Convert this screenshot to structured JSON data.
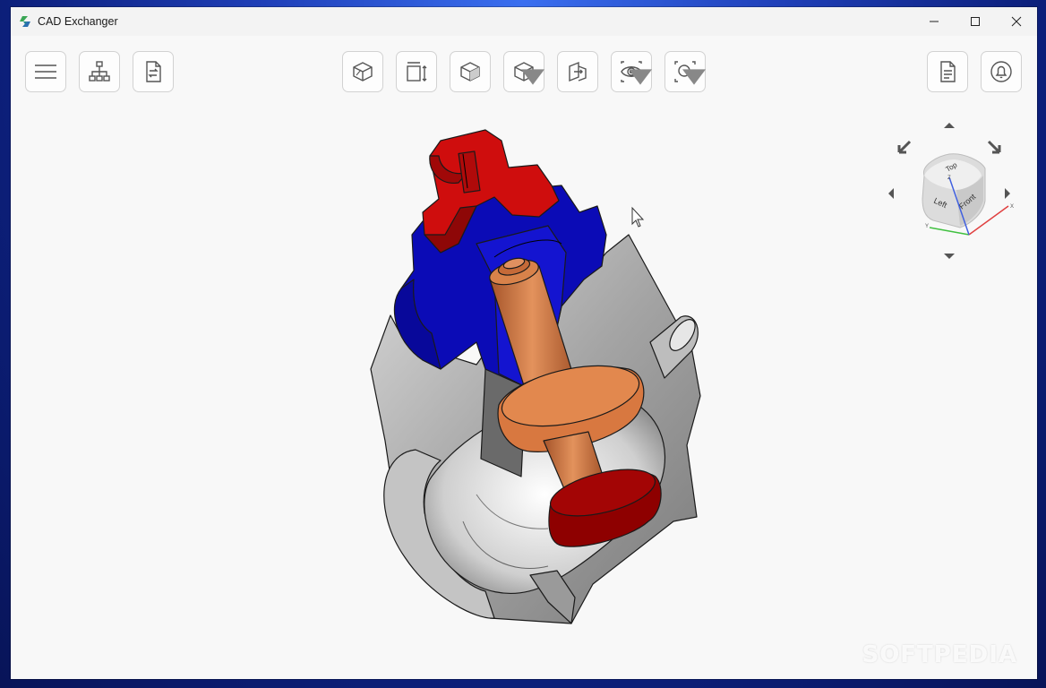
{
  "app": {
    "title": "CAD Exchanger",
    "brand_color": "#2e9a4a"
  },
  "window_controls": {
    "minimize": "minimize-icon",
    "maximize": "maximize-icon",
    "close": "close-icon"
  },
  "toolbar": {
    "left": [
      "menu-icon",
      "structure-tree-icon",
      "convert-file-icon"
    ],
    "center": [
      "view-mode-icon",
      "measure-icon",
      "shaded-view-icon",
      "display-mode-icon",
      "section-icon",
      "visibility-icon",
      "zoom-fit-icon"
    ],
    "right": [
      "properties-icon",
      "notifications-icon"
    ]
  },
  "navcube": {
    "faces": {
      "top": "Top",
      "front": "Front",
      "left": "Left"
    },
    "axes": {
      "x": "X",
      "y": "Y",
      "z": "Z"
    },
    "axis_colors": {
      "x": "#e04040",
      "y": "#40c040",
      "z": "#4060e0"
    }
  },
  "model": {
    "colors": {
      "cap": "#cc1010",
      "bonnet": "#0a0ab0",
      "stem": "#c8703a",
      "disc": "#a00000",
      "body": "#a8a8a8"
    }
  },
  "watermark": "SOFTPEDIA"
}
